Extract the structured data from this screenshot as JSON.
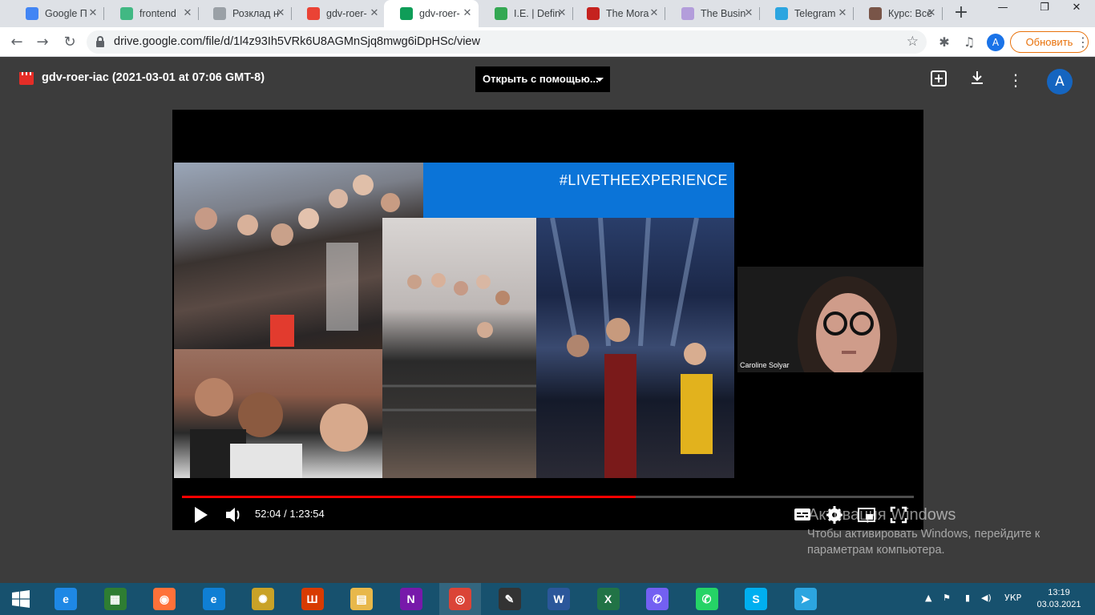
{
  "browser": {
    "tabs": [
      {
        "title": "Google П",
        "favicon": "google-translate-icon",
        "color": "#4285f4"
      },
      {
        "title": "frontend",
        "favicon": "vue-icon",
        "color": "#41b883"
      },
      {
        "title": "Розклад н",
        "favicon": "clock-icon",
        "color": "#9aa0a6"
      },
      {
        "title": "gdv-roer-",
        "favicon": "gmail-icon",
        "color": "#ea4335"
      },
      {
        "title": "gdv-roer-",
        "favicon": "google-drive-icon",
        "color": "#0f9d58",
        "active": true
      },
      {
        "title": "I.E. | Defin",
        "favicon": "l-icon",
        "color": "#34a853"
      },
      {
        "title": "The Mora",
        "favicon": "bookmark-icon",
        "color": "#c5221f"
      },
      {
        "title": "The Busin",
        "favicon": "flower-icon",
        "color": "#b39ddb"
      },
      {
        "title": "Telegram",
        "favicon": "telegram-icon",
        "color": "#2ca5e0"
      },
      {
        "title": "Курс: Всё",
        "favicon": "owl-icon",
        "color": "#795548"
      }
    ],
    "url": "drive.google.com/file/d/1l4z93Ih5VRk6U8AGMnSjq8mwg6iDpHSc/view",
    "profile_initial": "A",
    "update_label": "Обновить"
  },
  "viewer": {
    "file_title": "gdv-roer-iac (2021-03-01 at 07:06 GMT-8)",
    "open_with_label": "Открыть с помощью...",
    "account_initial": "A"
  },
  "video": {
    "slide_hashtag": "#LIVETHEEXPERIENCE",
    "participant_name": "Caroline Solyar",
    "current_time": "52:04",
    "duration": "1:23:54",
    "time_display": "52:04 / 1:23:54",
    "progress_fraction": 0.62,
    "accent_color": "#ff0000"
  },
  "watermark": {
    "line1": "Активация Windows",
    "line2": "Чтобы активировать Windows, перейдите к параметрам компьютера."
  },
  "taskbar": {
    "apps": [
      {
        "name": "internet-explorer-icon",
        "glyph": "e",
        "color": "#1e88e5"
      },
      {
        "name": "store-icon",
        "glyph": "▦",
        "color": "#2e7d32"
      },
      {
        "name": "firefox-icon",
        "glyph": "◉",
        "color": "#ff7139"
      },
      {
        "name": "edge-icon",
        "glyph": "e",
        "color": "#0f7fd4"
      },
      {
        "name": "app-icon",
        "glyph": "✺",
        "color": "#c9a227"
      },
      {
        "name": "office-icon",
        "glyph": "Ш",
        "color": "#d83b01"
      },
      {
        "name": "file-explorer-icon",
        "glyph": "▤",
        "color": "#e8b84a"
      },
      {
        "name": "onenote-icon",
        "glyph": "N",
        "color": "#7719aa"
      },
      {
        "name": "chrome-icon",
        "glyph": "◎",
        "color": "#db4437",
        "active": true
      },
      {
        "name": "reader-icon",
        "glyph": "✎",
        "color": "#333333"
      },
      {
        "name": "word-icon",
        "glyph": "W",
        "color": "#2b579a"
      },
      {
        "name": "excel-icon",
        "glyph": "X",
        "color": "#217346"
      },
      {
        "name": "viber-icon",
        "glyph": "✆",
        "color": "#7360f2"
      },
      {
        "name": "whatsapp-icon",
        "glyph": "✆",
        "color": "#25d366"
      },
      {
        "name": "skype-icon",
        "glyph": "S",
        "color": "#00aff0"
      },
      {
        "name": "telegram-icon",
        "glyph": "➤",
        "color": "#2ca5e0"
      }
    ],
    "language": "УКР",
    "time": "13:19",
    "date": "03.03.2021"
  }
}
